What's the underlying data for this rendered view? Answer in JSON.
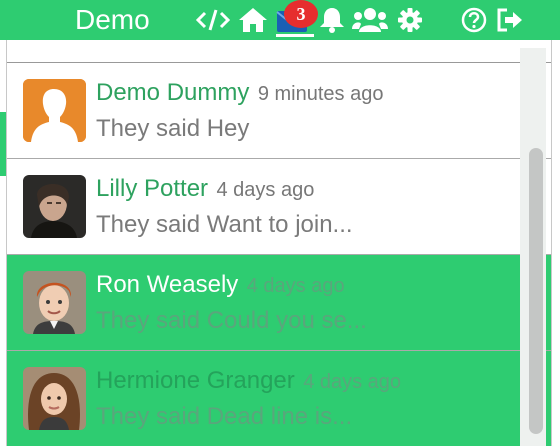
{
  "header": {
    "brand": "Demo",
    "badge_count": "3",
    "accent_color": "#2ecc71",
    "icons": [
      "code-icon",
      "home-icon",
      "envelope-icon",
      "bell-icon",
      "users-icon",
      "gear-icon",
      "help-icon",
      "logout-icon"
    ]
  },
  "messages": [
    {
      "sender": "Demo Dummy",
      "time": "9 minutes ago",
      "preview": "They said Hey",
      "avatar": "default-avatar-icon"
    },
    {
      "sender": "Lilly Potter",
      "time": "4 days ago",
      "preview": "They said Want to join...",
      "avatar": "user-photo"
    },
    {
      "sender": "Ron Weasely",
      "time": "4 days ago",
      "preview": "They said Could you se...",
      "avatar": "user-photo"
    },
    {
      "sender": "Hermione Granger",
      "time": "4 days ago",
      "preview": "They said Dead line is...",
      "avatar": "user-photo"
    }
  ]
}
